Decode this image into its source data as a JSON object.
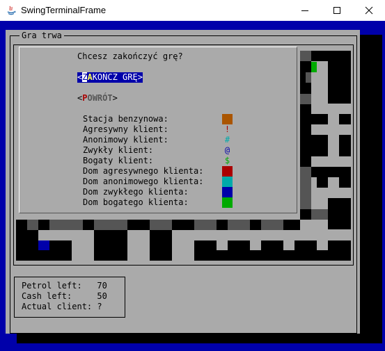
{
  "window": {
    "title": "SwingTerminalFrame"
  },
  "frame": {
    "title": "Gra trwa"
  },
  "dialog": {
    "question": "Chcesz zakończyć grę?",
    "end_button": {
      "bracket_left": "<",
      "cursor_char": "Z",
      "hot": "A",
      "rest": "KOŃCZ GRĘ",
      "bracket_right": ">"
    },
    "back_button": {
      "bracket_left": "<",
      "hot": "P",
      "rest": "OWRÓT",
      "bracket_right": ">"
    },
    "legend": [
      {
        "label": "Stacja benzynowa:",
        "symbol": "",
        "kind": "block",
        "color": "#aa5500"
      },
      {
        "label": "Agresywny klient:",
        "symbol": "!",
        "kind": "text",
        "color": "#aa0000"
      },
      {
        "label": "Anonimowy klient:",
        "symbol": "#",
        "kind": "text",
        "color": "#00aaaa"
      },
      {
        "label": "Zwykły klient:",
        "symbol": "@",
        "kind": "text",
        "color": "#0000aa"
      },
      {
        "label": "Bogaty klient:",
        "symbol": "$",
        "kind": "text",
        "color": "#00aa00"
      },
      {
        "label": "Dom agresywnego klienta:",
        "symbol": "",
        "kind": "block",
        "color": "#aa0000"
      },
      {
        "label": "Dom anonimowego klienta:",
        "symbol": "",
        "kind": "block",
        "color": "#00aaaa"
      },
      {
        "label": "Dom zwykłego klienta:",
        "symbol": "",
        "kind": "block",
        "color": "#0000aa"
      },
      {
        "label": "Dom bogatego klienta:",
        "symbol": "",
        "kind": "block",
        "color": "#00aa00"
      }
    ]
  },
  "status": {
    "petrol": "Petrol left:   70",
    "cash": "Cash left:     50",
    "client": "Actual client: ?"
  },
  "colors": {
    "terminal_bg": "#0000aa",
    "panel_bg": "#aaaaaa",
    "road": "#000000",
    "wall": "#555555",
    "selected_bg": "#0000aa",
    "hotkey": "#ffff55"
  }
}
